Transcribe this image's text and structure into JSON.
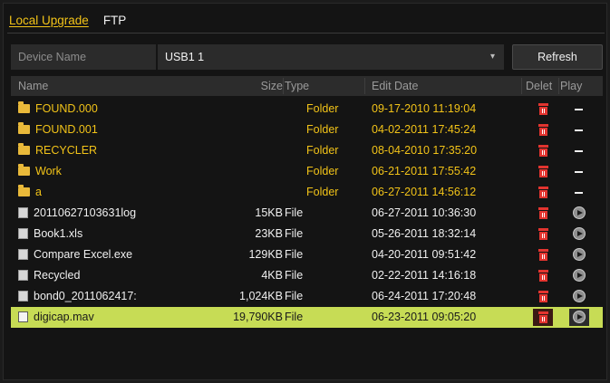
{
  "tabs": [
    {
      "label": "Local Upgrade",
      "active": true
    },
    {
      "label": "FTP",
      "active": false
    }
  ],
  "device": {
    "label": "Device Name",
    "value": "USB1 1",
    "refresh_label": "Refresh"
  },
  "table": {
    "headers": {
      "name": "Name",
      "size": "Size",
      "type": "Type",
      "date": "Edit Date",
      "delete": "Delet",
      "play": "Play"
    },
    "rows": [
      {
        "name": "FOUND.000",
        "size": "",
        "type": "Folder",
        "date": "09-17-2010 11:19:04",
        "kind": "folder"
      },
      {
        "name": "FOUND.001",
        "size": "",
        "type": "Folder",
        "date": "04-02-2011 17:45:24",
        "kind": "folder"
      },
      {
        "name": "RECYCLER",
        "size": "",
        "type": "Folder",
        "date": "08-04-2010 17:35:20",
        "kind": "folder"
      },
      {
        "name": "Work",
        "size": "",
        "type": "Folder",
        "date": "06-21-2011 17:55:42",
        "kind": "folder"
      },
      {
        "name": "a",
        "size": "",
        "type": "Folder",
        "date": "06-27-2011 14:56:12",
        "kind": "folder"
      },
      {
        "name": "20110627103631log",
        "size": "15KB",
        "type": "File",
        "date": "06-27-2011 10:36:30",
        "kind": "file"
      },
      {
        "name": "Book1.xls",
        "size": "23KB",
        "type": "File",
        "date": "05-26-2011 18:32:14",
        "kind": "file"
      },
      {
        "name": "Compare Excel.exe",
        "size": "129KB",
        "type": "File",
        "date": "04-20-2011 09:51:42",
        "kind": "file"
      },
      {
        "name": "Recycled",
        "size": "4KB",
        "type": "File",
        "date": "02-22-2011 14:16:18",
        "kind": "file"
      },
      {
        "name": "bond0_2011062417:",
        "size": "1,024KB",
        "type": "File",
        "date": "06-24-2011 17:20:48",
        "kind": "file"
      },
      {
        "name": "digicap.mav",
        "size": "19,790KB",
        "type": "File",
        "date": "06-23-2011 09:05:20",
        "kind": "file",
        "selected": true
      }
    ]
  },
  "colors": {
    "accent": "#f2c318",
    "selected_row": "#c7dc55",
    "delete": "#e3342f"
  }
}
